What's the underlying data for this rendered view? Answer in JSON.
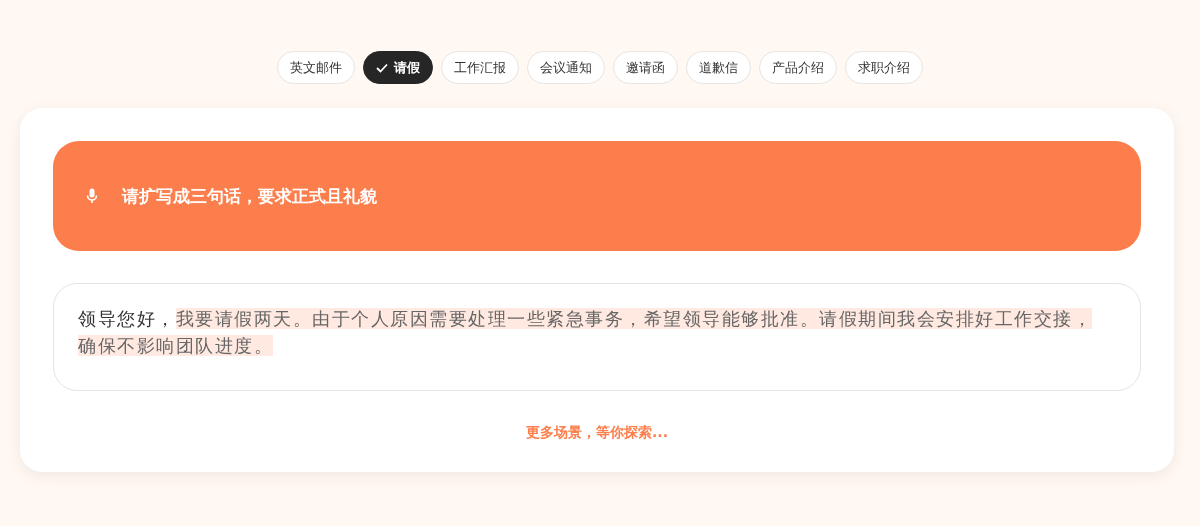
{
  "tabs": [
    {
      "label": "英文邮件",
      "selected": false
    },
    {
      "label": "请假",
      "selected": true
    },
    {
      "label": "工作汇报",
      "selected": false
    },
    {
      "label": "会议通知",
      "selected": false
    },
    {
      "label": "邀请函",
      "selected": false
    },
    {
      "label": "道歉信",
      "selected": false
    },
    {
      "label": "产品介绍",
      "selected": false
    },
    {
      "label": "求职介绍",
      "selected": false
    }
  ],
  "prompt": {
    "text": "请扩写成三句话，要求正式且礼貌"
  },
  "answer": {
    "segments": [
      {
        "text": "领导您好，",
        "highlighted": false
      },
      {
        "text": "我要请假两天。由于个人原因需要处理一些紧急事务，希望领导能够批准。请假期间我会安排好工作交接，确保不影响团队进度。",
        "highlighted": true
      }
    ]
  },
  "more_link": "更多场景，等你探索..."
}
